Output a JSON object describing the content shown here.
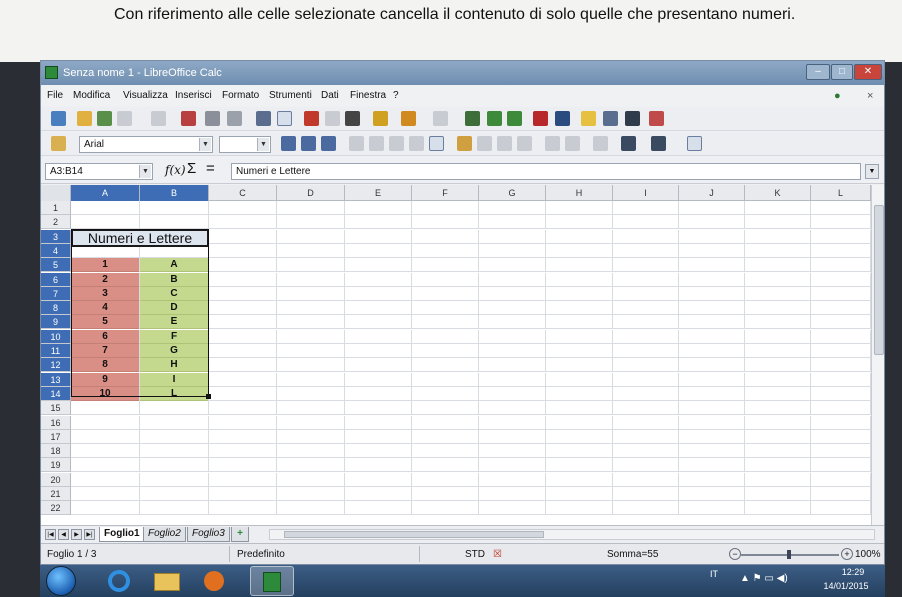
{
  "instruction": "Con riferimento alle celle selezionate cancella il contenuto di solo quelle che presentano numeri.",
  "window": {
    "title": "Senza nome 1 - LibreOffice Calc"
  },
  "menu": [
    "File",
    "Modifica",
    "Visualizza",
    "Inserisci",
    "Formato",
    "Strumenti",
    "Dati",
    "Finestra",
    "?"
  ],
  "menu_close_glyph": "×",
  "format_toolbar": {
    "font_name": "Arial",
    "font_size": ""
  },
  "formula_bar": {
    "name_box": "A3:B14",
    "fx_glyph": "f(x)",
    "sum_glyph": "Σ",
    "equals_glyph": "=",
    "content": "Numeri e Lettere"
  },
  "columns": [
    "A",
    "B",
    "C",
    "D",
    "E",
    "F",
    "G",
    "H",
    "I",
    "J",
    "K",
    "L"
  ],
  "rows": [
    "1",
    "2",
    "3",
    "4",
    "5",
    "6",
    "7",
    "8",
    "9",
    "10",
    "11",
    "12",
    "13",
    "14",
    "15",
    "16",
    "17",
    "18",
    "19",
    "20",
    "21",
    "22"
  ],
  "sheet": {
    "merged_title": "Numeri e Lettere",
    "numbers": [
      "1",
      "2",
      "3",
      "4",
      "5",
      "6",
      "7",
      "8",
      "9",
      "10"
    ],
    "letters": [
      "A",
      "B",
      "C",
      "D",
      "E",
      "F",
      "G",
      "H",
      "I",
      "L"
    ]
  },
  "tabs": [
    "Foglio1",
    "Foglio2",
    "Foglio3"
  ],
  "status": {
    "sheet_info": "Foglio 1 / 3",
    "page_style": "Predefinito",
    "mode": "STD",
    "sum": "Somma=55",
    "zoom": "100%"
  },
  "taskbar": {
    "lang": "IT",
    "time": "12:29",
    "date": "14/01/2015"
  },
  "colors": {
    "numbers_fill": "#d98f86",
    "letters_fill": "#c5d98e",
    "selection_header": "#3e6db5"
  }
}
